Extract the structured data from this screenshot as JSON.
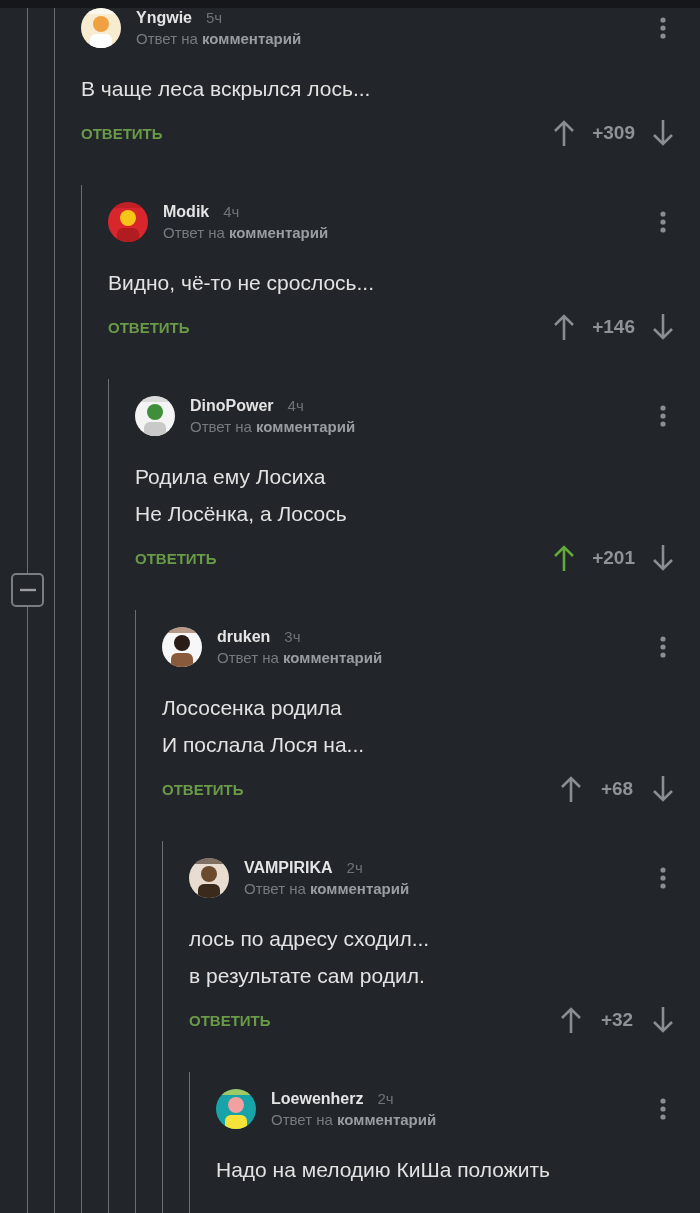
{
  "comments": [
    {
      "author": "Yngwie",
      "time": "5ч",
      "reply_to": "Ответ на **комментарий**",
      "text": [
        "В чаще леса вскрылся лось..."
      ],
      "reply_button": "ОТВЕТИТЬ",
      "score": "+309",
      "upvoted": false,
      "children": [
        {
          "author": "Modik",
          "time": "4ч",
          "reply_to": "Ответ на **комментарий**",
          "text": [
            "Видно, чё-то не срослось..."
          ],
          "reply_button": "ОТВЕТИТЬ",
          "score": "+146",
          "upvoted": false,
          "children": [
            {
              "author": "DinoPower",
              "time": "4ч",
              "reply_to": "Ответ на **комментарий**",
              "text": [
                "Родила ему Лосиха",
                "Не Лосёнка, а Лосось"
              ],
              "reply_button": "ОТВЕТИТЬ",
              "score": "+201",
              "upvoted": true,
              "children": [
                {
                  "author": "druken",
                  "time": "3ч",
                  "reply_to": "Ответ на **комментарий**",
                  "text": [
                    "Лососенка родила",
                    "И послала Лося на..."
                  ],
                  "reply_button": "ОТВЕТИТЬ",
                  "score": "+68",
                  "upvoted": false,
                  "children": [
                    {
                      "author": "VAMPIRIKA",
                      "time": "2ч",
                      "reply_to": "Ответ на **комментарий**",
                      "text": [
                        "лось по адресу сходил...",
                        "в результате сам родил."
                      ],
                      "reply_button": "ОТВЕТИТЬ",
                      "score": "+32",
                      "upvoted": false,
                      "children": [
                        {
                          "author": "Loewenherz",
                          "time": "2ч",
                          "reply_to": "Ответ на **комментарий**",
                          "text": [
                            "Надо на мелодию КиШа положить"
                          ]
                        }
                      ]
                    }
                  ]
                }
              ]
            }
          ]
        }
      ]
    }
  ]
}
